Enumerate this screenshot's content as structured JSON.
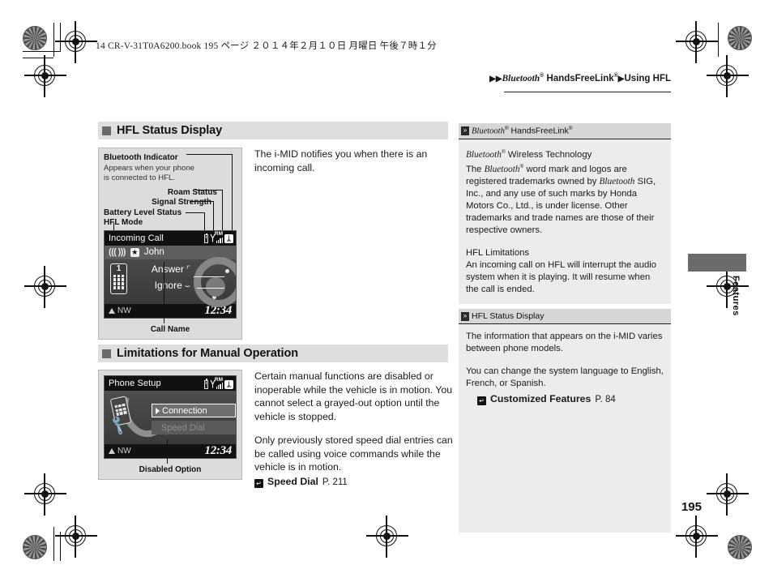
{
  "print_header": {
    "text": "14 CR-V-31T0A6200.book    195 ページ    ２０１４年２月１０日    月曜日    午後７時１分"
  },
  "breadcrumb": {
    "arrow1": "▶▶",
    "part1": "Bluetooth",
    "sup1": "®",
    "part2": " HandsFreeLink",
    "sup2": "®",
    "arrow2": "▶",
    "part3": "Using HFL"
  },
  "sections": [
    {
      "title": "HFL Status Display",
      "body": "The i-MID notifies you when there is an incoming call.",
      "figure": {
        "callouts": [
          {
            "label": "Bluetooth Indicator"
          },
          {
            "label": "Appears when your phone"
          },
          {
            "label": "is connected to HFL."
          },
          {
            "label": "Roam Status"
          },
          {
            "label": "Signal Strength"
          },
          {
            "label": "Battery Level Status"
          },
          {
            "label": "HFL Mode"
          }
        ],
        "screen": {
          "title": "Incoming Call",
          "ring_waves": "((( )))",
          "star": "★",
          "caller": "John",
          "keypad_number": "1",
          "option_answer": "Answer",
          "option_ignore": "Ignore",
          "compass": "NW",
          "clock": "12:34",
          "roam_text": "RM",
          "bluetooth_glyph": "ᛦ"
        },
        "caption": "Call Name"
      }
    },
    {
      "title": "Limitations for Manual Operation",
      "body_p1": "Certain manual functions are disabled or inoperable while the vehicle is in motion. You cannot select a grayed-out option until the vehicle is stopped.",
      "body_p2": "Only previously stored speed dial entries can be called using voice commands while the vehicle is in motion.",
      "reference": {
        "icon": "↵",
        "label": "Speed Dial",
        "page": "P. 211"
      },
      "figure": {
        "screen": {
          "title": "Phone Setup",
          "item_enabled": "Connection",
          "item_disabled": "Speed Dial",
          "compass": "NW",
          "clock": "12:34",
          "roam_text": "RM",
          "bluetooth_glyph": "ᛦ"
        },
        "caption": "Disabled Option"
      }
    }
  ],
  "notes": [
    {
      "tab_part1": "Bluetooth",
      "tab_sup1": "®",
      "tab_part2": " HandsFreeLink",
      "tab_sup2": "®",
      "heading1": "Bluetooth",
      "heading1_sup": "®",
      "heading1_rest": " Wireless Technology",
      "para1_a": "The ",
      "para1_i1": "Bluetooth",
      "para1_sup1": "®",
      "para1_b": " word mark and logos are registered trademarks owned by ",
      "para1_i2": "Bluetooth",
      "para1_c": " SIG, Inc., and any use of such marks by Honda Motors Co., Ltd., is under license. Other trademarks and trade names are those of their respective owners.",
      "heading2": "HFL Limitations",
      "para2": "An incoming call on HFL will interrupt the audio system when it is playing. It will resume when the call is ended."
    },
    {
      "tab_title": "HFL Status Display",
      "para1": "The information that appears on the i-MID varies between phone models.",
      "para2": "You can change the system language to English, French, or Spanish.",
      "reference": {
        "icon": "↵",
        "label": "Customized Features",
        "page": "P. 84"
      }
    }
  ],
  "footer": {
    "page_number": "195",
    "side_tab_label": "Features"
  }
}
